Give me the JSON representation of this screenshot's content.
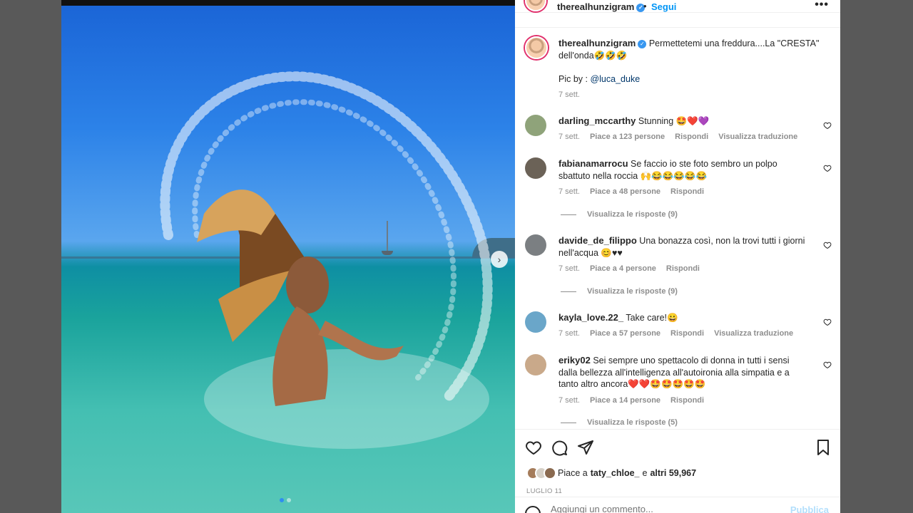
{
  "post": {
    "username": "therealhunzigram",
    "follow_label": "Segui",
    "bullet": "•",
    "more_label": "•••"
  },
  "caption": {
    "username": "therealhunzigram",
    "text_line1": "Permettetemi una freddura....La \"CRESTA\"",
    "text_line2": "dell'onda🤣🤣🤣",
    "pic_by": "Pic by : ",
    "pic_handle": "@luca_duke",
    "time": "7 sett."
  },
  "comments": [
    {
      "username": "darling_mccarthy",
      "line1": "Stunning 🤩❤️💜",
      "line2": "",
      "time": "7 sett.",
      "likes": "Piace a 123 persone",
      "reply": "Rispondi",
      "translate": "Visualizza traduzione",
      "replies": "",
      "avatar_color": "#8fa37a"
    },
    {
      "username": "fabianamarrocu",
      "line1": "Se faccio io ste foto sembro un polpo",
      "line2": "sbattuto nella roccia 🙌😂😂😂😂😂",
      "time": "7 sett.",
      "likes": "Piace a 48 persone",
      "reply": "Rispondi",
      "translate": "",
      "replies": "Visualizza le risposte (9)",
      "avatar_color": "#6b6257"
    },
    {
      "username": "davide_de_filippo",
      "line1": "Una bonazza così, non la trovi tutti i giorni",
      "line2": "nell'acqua 😊♥♥",
      "time": "7 sett.",
      "likes": "Piace a 4 persone",
      "reply": "Rispondi",
      "translate": "",
      "replies": "Visualizza le risposte (9)",
      "avatar_color": "#7b7f82"
    },
    {
      "username": "kayla_love.22_",
      "line1": "Take care!😀",
      "line2": "",
      "time": "7 sett.",
      "likes": "Piace a 57 persone",
      "reply": "Rispondi",
      "translate": "Visualizza traduzione",
      "replies": "",
      "avatar_color": "#6aa6c9"
    },
    {
      "username": "eriky02",
      "line1": "Sei sempre uno spettacolo di donna in tutti i sensi",
      "line2": "dalla bellezza all'intelligenza all'autoironia alla simpatia e a",
      "line3": "tanto altro ancora❤️❤️🤩🤩🤩🤩🤩",
      "time": "7 sett.",
      "likes": "Piace a 14 persone",
      "reply": "Rispondi",
      "translate": "",
      "replies": "Visualizza le risposte (5)",
      "avatar_color": "#c9a98a"
    }
  ],
  "likes_bar": {
    "prefix": "Piace a",
    "user": "taty_chloe_",
    "suffix": "e",
    "others": "altri 59,967",
    "date": "LUGLIO 11"
  },
  "add_comment": {
    "placeholder": "Aggiungi un commento...",
    "publish": "Pubblica"
  },
  "icons": [
    "heart-icon",
    "comment-icon",
    "share-icon",
    "bookmark-icon",
    "verified-icon",
    "next-arrow-icon",
    "smile-icon"
  ],
  "colors": {
    "accent": "#0095f6",
    "muted": "#8e8e8e",
    "verified": "#3897f0"
  }
}
